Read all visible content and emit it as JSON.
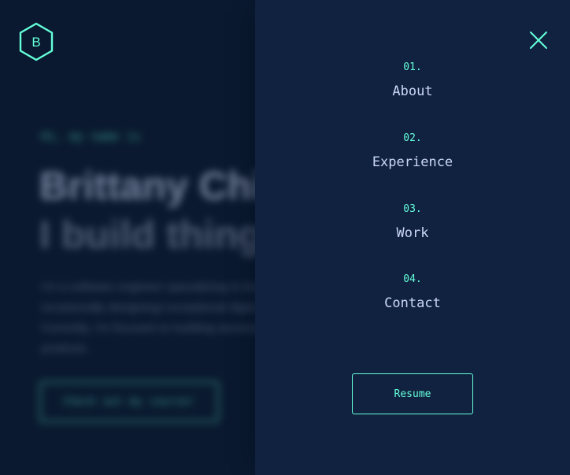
{
  "logo": {
    "letter": "B",
    "icon": "hexagon-logo-icon"
  },
  "hero": {
    "intro": "Hi, my name is",
    "name": "Brittany Chiang.",
    "tagline": "I build things for the web.",
    "description": "I'm a software engineer specializing in building (and occasionally designing) exceptional digital experiences. Currently, I'm focused on building accessible, human-centered products.",
    "cta_label": "Check out my course!"
  },
  "menu": {
    "close_icon": "close-icon",
    "items": [
      {
        "number": "01.",
        "label": "About"
      },
      {
        "number": "02.",
        "label": "Experience"
      },
      {
        "number": "03.",
        "label": "Work"
      },
      {
        "number": "04.",
        "label": "Contact"
      }
    ],
    "resume_label": "Resume"
  },
  "colors": {
    "background": "#0a192f",
    "menu_background": "#112240",
    "accent": "#64ffda",
    "text_light": "#ccd6f6",
    "text_slate": "#8892b0"
  }
}
